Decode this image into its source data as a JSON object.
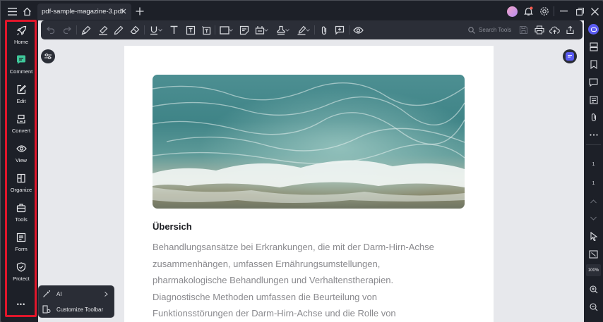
{
  "titlebar": {
    "tab_title": "pdf-sample-magazine-3.pdf",
    "icons": [
      "menu-icon",
      "home-icon",
      "close-icon",
      "plus-icon",
      "avatar",
      "bell-icon",
      "gear-icon",
      "upload-icon",
      "minimize-icon",
      "restore-icon",
      "close-window-icon"
    ]
  },
  "sidebar": {
    "items": [
      {
        "label": "Home",
        "icon": "rocket-icon"
      },
      {
        "label": "Comment",
        "icon": "comment-icon"
      },
      {
        "label": "Edit",
        "icon": "edit-icon"
      },
      {
        "label": "Convert",
        "icon": "convert-icon"
      },
      {
        "label": "View",
        "icon": "eye-icon"
      },
      {
        "label": "Organize",
        "icon": "organize-icon"
      },
      {
        "label": "Tools",
        "icon": "toolbox-icon"
      },
      {
        "label": "Form",
        "icon": "form-icon"
      },
      {
        "label": "Protect",
        "icon": "shield-icon"
      }
    ],
    "more": "•••",
    "highlight_color": "#e0162b"
  },
  "toolbar": {
    "search_placeholder": "Search Tools"
  },
  "popup": {
    "ai_label": "AI",
    "customize_label": "Customize Toolbar"
  },
  "document": {
    "heading": "Übersich",
    "lines": [
      "Behandlungsansätze bei Erkrankungen, die mit der Darm-Hirn-Achse",
      "zusammenhängen, umfassen Ernährungsumstellungen,",
      "pharmakologische Behandlungen und Verhaltenstherapien.",
      "Diagnostische Methoden umfassen die Beurteilung von",
      "Funktionsstörungen der Darm-Hirn-Achse und die Rolle von"
    ]
  },
  "right_sidebar": {
    "current_page": "1",
    "total_pages": "1",
    "zoom": "100%"
  },
  "colors": {
    "accent_comment": "#3fc79a",
    "ai_badge": "#5b5cf2"
  }
}
